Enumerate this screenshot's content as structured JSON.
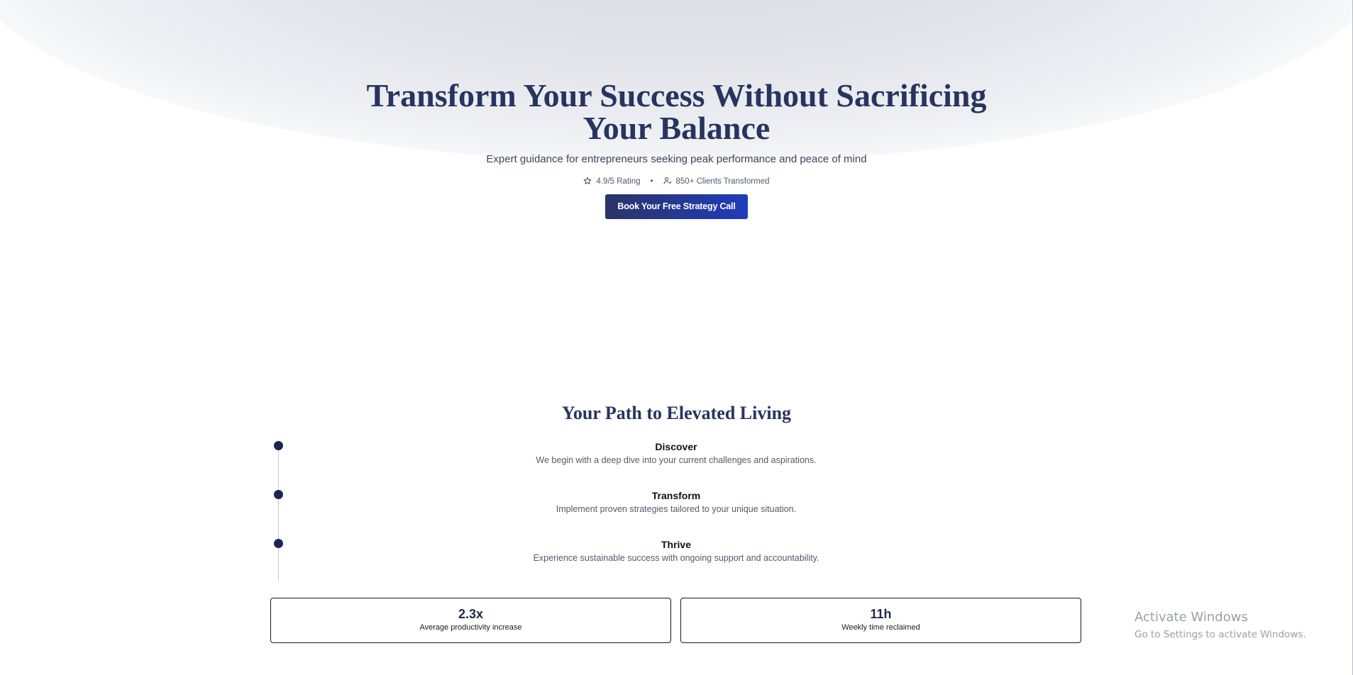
{
  "hero": {
    "title": "Transform Your Success Without Sacrificing Your Balance",
    "subtitle": "Expert guidance for entrepreneurs seeking peak performance and peace of mind",
    "rating": "4.9/5 Rating",
    "separator": "•",
    "clients": "850+ Clients Transformed",
    "cta_label": "Book Your Free Strategy Call",
    "rating_icon": "star-outline-icon",
    "clients_icon": "user-check-icon"
  },
  "path": {
    "title": "Your Path to Elevated Living",
    "steps": [
      {
        "title": "Discover",
        "description": "We begin with a deep dive into your current challenges and aspirations."
      },
      {
        "title": "Transform",
        "description": "Implement proven strategies tailored to your unique situation."
      },
      {
        "title": "Thrive",
        "description": "Experience sustainable success with ongoing support and accountability."
      }
    ]
  },
  "stats": [
    {
      "value": "2.3x",
      "label": "Average productivity increase"
    },
    {
      "value": "11h",
      "label": "Weekly time reclaimed"
    }
  ],
  "watermark": {
    "title": "Activate Windows",
    "subtitle": "Go to Settings to activate Windows."
  },
  "colors": {
    "heading": "#27345f",
    "cta_start": "#2b3468",
    "cta_end": "#1f3cbc",
    "timeline_dot": "#1b2550"
  }
}
